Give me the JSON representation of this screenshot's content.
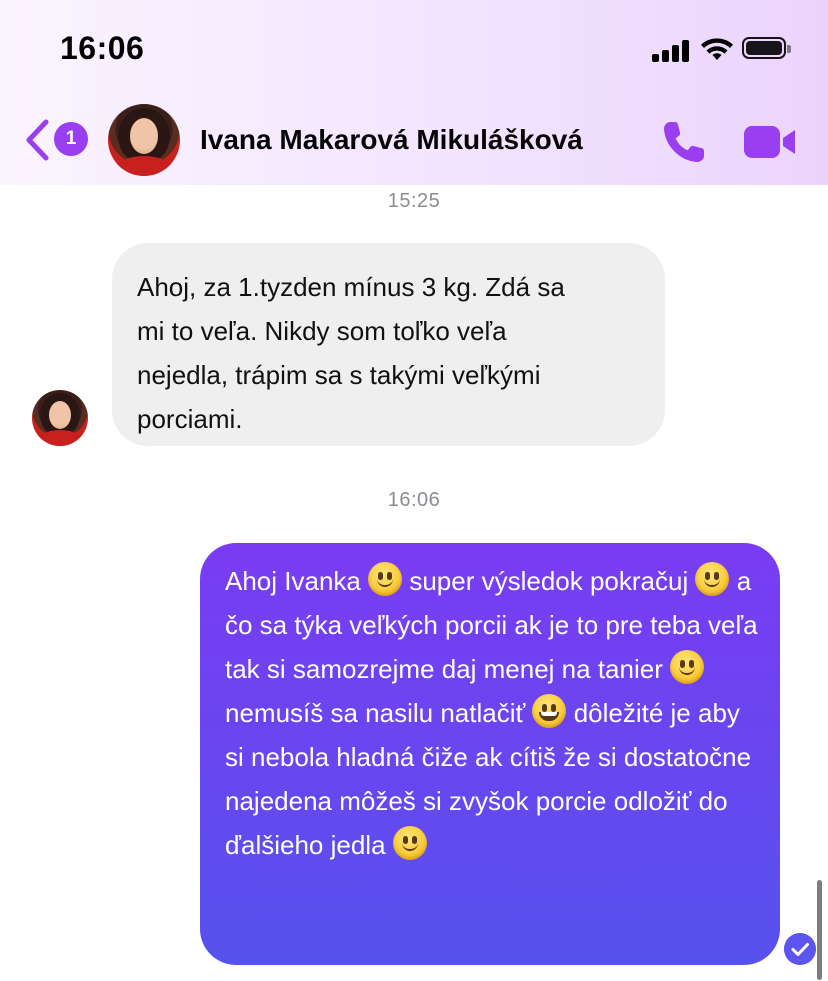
{
  "status_bar": {
    "time": "16:06"
  },
  "header": {
    "unread_badge": "1",
    "contact_name": "Ivana Makarová Mikulášková",
    "icons": {
      "back": "chevron-left-icon",
      "call": "phone-icon",
      "video": "video-camera-icon"
    },
    "accent_color": "#9a3ff0"
  },
  "messages": [
    {
      "timestamp": "15:25",
      "direction": "incoming",
      "text": "Ahoj, za 1.tyzden mínus 3 kg. Zdá sa\nmi to veľa. Nikdy som toľko veľa\nnejedla, trápim sa s takými veľkými\nporciami."
    },
    {
      "timestamp": "16:06",
      "direction": "outgoing",
      "segments": {
        "s1": "Ahoj Ivanka ",
        "s2": " super výsledok pokračuj ",
        "s3": " a čo sa týka veľkých porcii ak je to pre teba veľa tak si samozrejme daj menej na tanier ",
        "s4": " nemusíš sa nasilu natlačiť ",
        "s5": " dôležité je aby si nebola hladná čiže ak cítiš že si dostatočne najedena môžeš si zvyšok porcie odložiť do ďalšieho jedla "
      },
      "emojis": [
        "slightly-smiling-face",
        "slightly-smiling-face",
        "slightly-smiling-face",
        "grinning-face",
        "slightly-smiling-face"
      ],
      "status": "seen"
    }
  ],
  "colors": {
    "incoming_bubble": "#efeff0",
    "outgoing_gradient_top": "#7a3cf2",
    "outgoing_gradient_bottom": "#5652ee",
    "timestamp": "#8a8d91"
  }
}
